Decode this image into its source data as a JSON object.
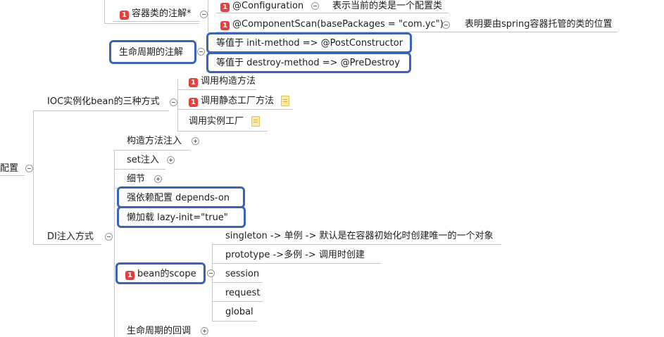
{
  "root": {
    "label": "配置"
  },
  "annotations": {
    "container_label": "容器类的注解*",
    "configuration": "@Configuration",
    "configuration_desc": "表示当前的类是一个配置类",
    "component_scan": "@ComponentScan(basePackages = \"com.yc\")",
    "component_scan_desc": "表明要由spring容器托管的类的位置",
    "lifecycle_label": "生命周期的注解",
    "init_method": "等值于 init-method =>  @PostConstructor",
    "destroy_method": "等值于 destroy-method  =>  @PreDestroy"
  },
  "ioc": {
    "label": "IOC实例化bean的三种方式",
    "children": [
      "调用构造方法",
      "调用静态工厂方法",
      "调用实例工厂"
    ]
  },
  "di": {
    "label": "DI注入方式",
    "constructor": "构造方法注入",
    "set": "set注入",
    "detail": "细节",
    "depends_on": "强依赖配置   depends-on",
    "lazy_init": "懒加载    lazy-init=\"true\"",
    "scope_label": "bean的scope",
    "scopes": [
      "singleton -> 单例 -> 默认是在容器初始化时创建唯一的一个对象",
      "prototype   ->多例  -> 调用时创建",
      "session",
      "request",
      "global"
    ],
    "lifecycle_callback": "生命周期的回调"
  },
  "priority_marker": "1",
  "colors": {
    "highlight_border": "#3d64b4",
    "priority_badge": "#e2413d",
    "branch_line": "#c7c7c7",
    "note_icon": "#fbe9a6"
  },
  "icons": [
    "priority-1-icon",
    "note-icon",
    "collapse-icon",
    "expand-icon"
  ]
}
